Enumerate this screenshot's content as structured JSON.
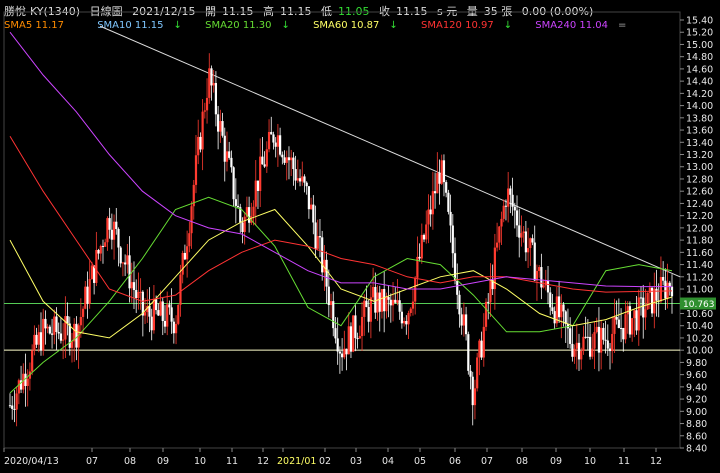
{
  "header": {
    "stock": "勝悅-KY(1340)",
    "period": "日線圖",
    "date": "2021/12/15",
    "open_label": "開",
    "open": "11.15",
    "high_label": "高",
    "high": "11.15",
    "low_label": "低",
    "low": "11.05",
    "close_label": "收",
    "close": "11.15",
    "close_unit": "s 元",
    "volume_label": "量",
    "volume": "35 張",
    "change": "0.00 (0.00%)"
  },
  "legend": [
    {
      "text": "SMA5 11.17",
      "arrow": "",
      "color": "#ff8c00"
    },
    {
      "text": "SMA10 11.15",
      "arrow": "↓",
      "color": "#7fc7ff"
    },
    {
      "text": "SMA20 11.30",
      "arrow": "↓",
      "color": "#66dd33"
    },
    {
      "text": "SMA60 10.87",
      "arrow": "↓",
      "color": "#ffff66"
    },
    {
      "text": "SMA120 10.97",
      "arrow": "↓",
      "color": "#ff3333"
    },
    {
      "text": "SMA240 11.04",
      "arrow": "=",
      "color": "#cc44ff"
    }
  ],
  "chart_data": {
    "type": "line",
    "ylim": [
      8.4,
      15.5
    ],
    "y_ticks": [
      "15.40",
      "15.20",
      "15.00",
      "14.80",
      "14.60",
      "14.40",
      "14.20",
      "14.00",
      "13.80",
      "13.60",
      "13.40",
      "13.20",
      "13.00",
      "12.80",
      "12.60",
      "12.40",
      "12.20",
      "12.00",
      "11.80",
      "11.60",
      "11.40",
      "11.20",
      "11.00",
      "10.80",
      "10.60",
      "10.40",
      "10.20",
      "10.00",
      "9.80",
      "9.60",
      "9.40",
      "9.20",
      "9.00",
      "8.80",
      "8.60",
      "8.40"
    ],
    "x_ticks": [
      "2020/04/13",
      "07",
      "08",
      "09",
      "10",
      "11",
      "12",
      "2021/01",
      "02",
      "03",
      "04",
      "05",
      "06",
      "07",
      "08",
      "09",
      "10",
      "11",
      "12"
    ],
    "price_badge": "10.763",
    "reference_lines": [
      {
        "name": "support",
        "value": 10.0,
        "color": "#ffffcc"
      },
      {
        "name": "sma60-level",
        "value": 10.763,
        "color": "#55cc55"
      }
    ],
    "trendline": {
      "from": [
        "2020/07",
        15.3
      ],
      "to": [
        "2021/12",
        11.2
      ],
      "color": "#dddddd"
    },
    "price_series": [
      {
        "x": "2020/04",
        "y": 9.1
      },
      {
        "x": "2020/05",
        "y": 10.3
      },
      {
        "x": "2020/06",
        "y": 10.3
      },
      {
        "x": "2020/07",
        "y": 12.2
      },
      {
        "x": "2020/08",
        "y": 10.6
      },
      {
        "x": "2020/09",
        "y": 10.5
      },
      {
        "x": "2020/10",
        "y": 14.5
      },
      {
        "x": "2020/11",
        "y": 12.0
      },
      {
        "x": "2020/12",
        "y": 13.6
      },
      {
        "x": "2021/01",
        "y": 12.5
      },
      {
        "x": "2021/02",
        "y": 10.0
      },
      {
        "x": "2021/03",
        "y": 10.8
      },
      {
        "x": "2021/04",
        "y": 10.6
      },
      {
        "x": "2021/05",
        "y": 13.0
      },
      {
        "x": "2021/06",
        "y": 9.3
      },
      {
        "x": "2021/07",
        "y": 12.6
      },
      {
        "x": "2021/08",
        "y": 11.2
      },
      {
        "x": "2021/09",
        "y": 10.1
      },
      {
        "x": "2021/10",
        "y": 10.2
      },
      {
        "x": "2021/11",
        "y": 10.6
      },
      {
        "x": "2021/12",
        "y": 11.15
      }
    ],
    "sma_series": [
      {
        "name": "SMA20",
        "color": "#66dd33",
        "values": [
          9.3,
          9.8,
          10.2,
          10.8,
          11.5,
          12.3,
          12.5,
          12.3,
          11.7,
          10.7,
          10.4,
          11.2,
          11.5,
          11.4,
          10.9,
          10.3,
          10.3,
          10.4,
          11.3,
          11.4,
          11.3
        ]
      },
      {
        "name": "SMA60",
        "color": "#ffff66",
        "values": [
          11.8,
          10.8,
          10.3,
          10.2,
          10.6,
          11.2,
          11.8,
          12.1,
          12.3,
          11.7,
          11.0,
          10.8,
          11.0,
          11.2,
          11.3,
          11.0,
          10.6,
          10.4,
          10.5,
          10.7,
          10.87
        ]
      },
      {
        "name": "SMA120",
        "color": "#ff3333",
        "values": [
          13.5,
          12.6,
          11.8,
          11.0,
          10.8,
          10.9,
          11.3,
          11.6,
          11.8,
          11.7,
          11.5,
          11.4,
          11.2,
          11.1,
          11.2,
          11.2,
          11.1,
          11.0,
          10.95,
          10.96,
          10.97
        ]
      },
      {
        "name": "SMA240",
        "color": "#cc44ff",
        "values": [
          15.2,
          14.5,
          13.9,
          13.2,
          12.6,
          12.2,
          12.0,
          11.9,
          11.6,
          11.3,
          11.1,
          11.1,
          11.0,
          11.0,
          11.1,
          11.2,
          11.15,
          11.1,
          11.05,
          11.04,
          11.04
        ]
      }
    ]
  }
}
